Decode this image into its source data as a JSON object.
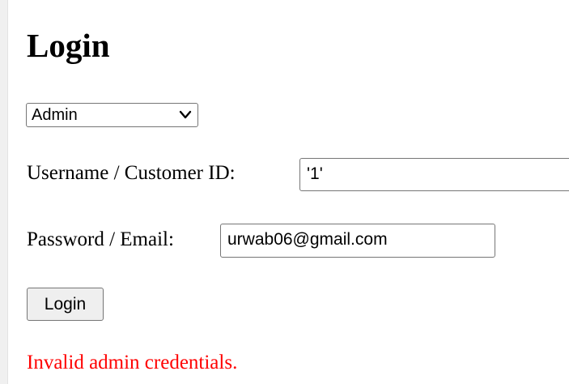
{
  "page": {
    "title": "Login"
  },
  "form": {
    "role_select": {
      "selected": "Admin"
    },
    "username": {
      "label": "Username / Customer ID:",
      "value": "'1'"
    },
    "password": {
      "label": "Password / Email:",
      "value": "urwab06@gmail.com"
    },
    "submit_label": "Login"
  },
  "error": {
    "message": "Invalid admin credentials.",
    "color": "#ff0000"
  },
  "icons": {
    "select_arrow": "chevron-down-icon"
  }
}
